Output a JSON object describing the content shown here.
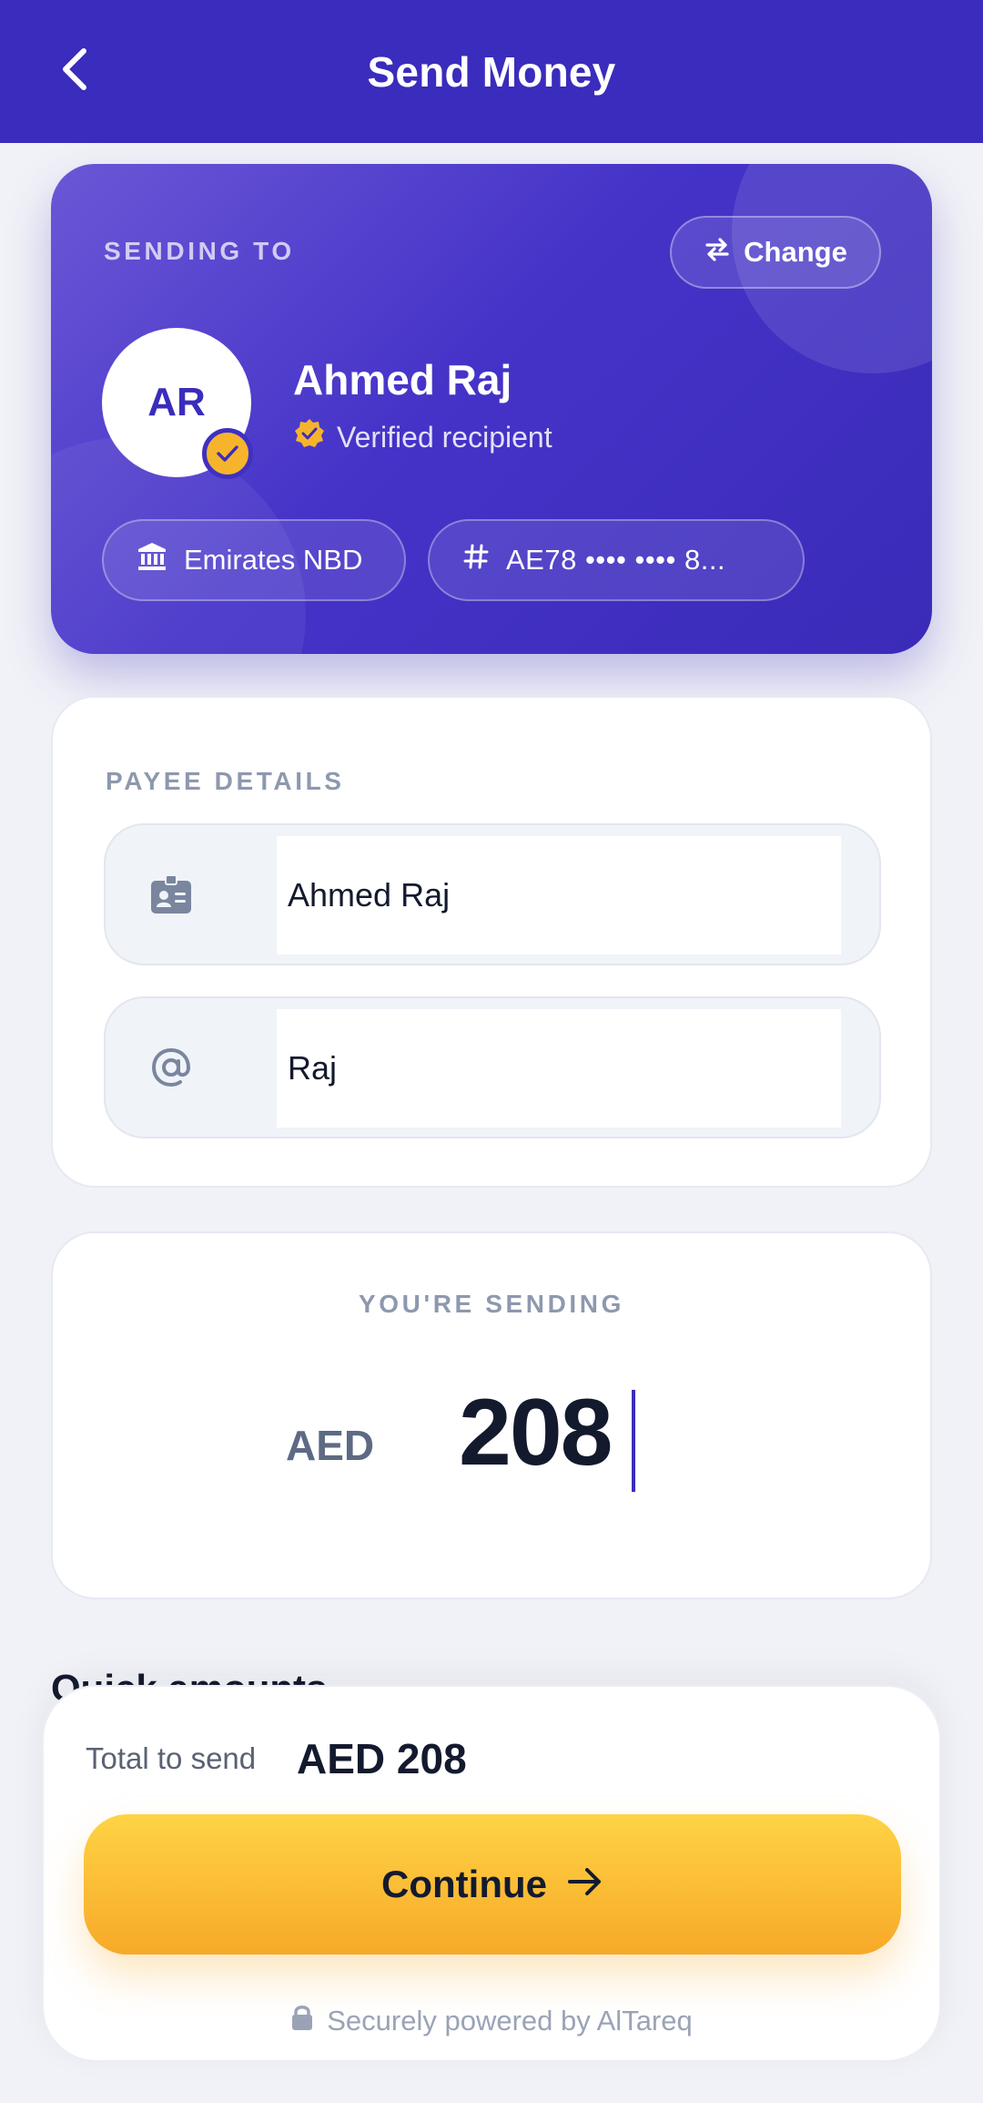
{
  "header": {
    "title": "Send Money",
    "back_icon": "chevron-left-icon"
  },
  "recipient": {
    "section_label": "SENDING TO",
    "change_label": "Change",
    "change_icon": "swap-arrows-icon",
    "initials": "AR",
    "name": "Ahmed Raj",
    "verified_text": "Verified recipient",
    "bank": "Emirates NBD",
    "bank_icon": "bank-icon",
    "iban_icon": "hash-icon",
    "iban": "AE78 •••• •••• 8..."
  },
  "payee": {
    "section_label": "PAYEE DETAILS",
    "name_value": "Ahmed Raj",
    "name_icon": "id-badge-icon",
    "handle_value": "Raj",
    "handle_icon": "at-icon"
  },
  "amount": {
    "section_label": "YOU'RE SENDING",
    "currency": "AED",
    "value": "208"
  },
  "quick_amounts": {
    "title": "Quick amounts"
  },
  "summary": {
    "total_label": "Total to send",
    "total_value": "AED 208",
    "continue_label": "Continue",
    "continue_icon": "arrow-right-icon",
    "secure_icon": "lock-icon",
    "secure_text": "Securely powered by AlTareq"
  },
  "colors": {
    "primary": "#3a2cbc",
    "accent": "#f7a928",
    "background": "#f1f2f7"
  }
}
